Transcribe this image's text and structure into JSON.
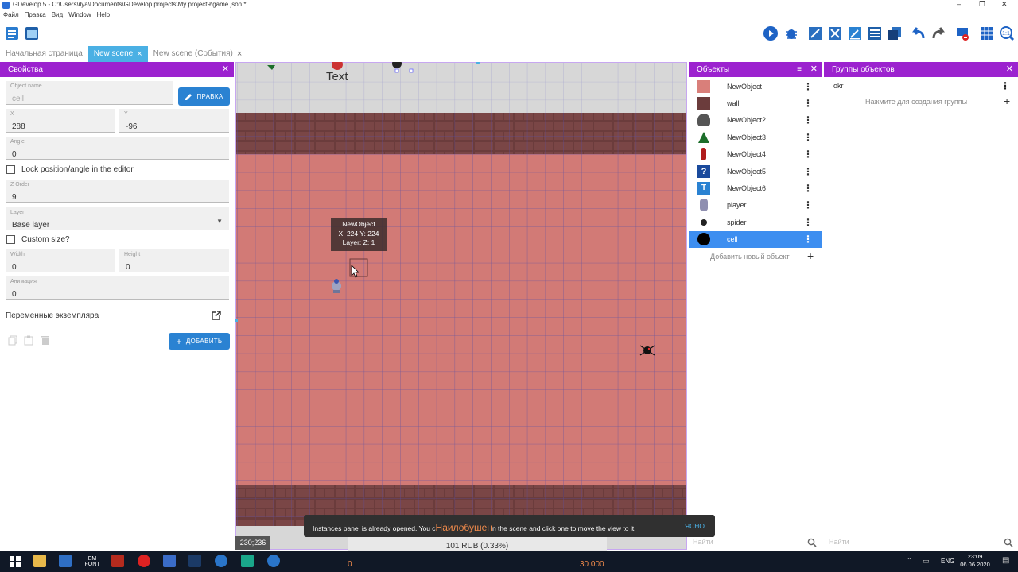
{
  "window": {
    "title": "GDevelop 5 - C:\\Users\\ilya\\Documents\\GDevelop projects\\My project9\\game.json *",
    "minimize": "–",
    "maximize": "❐",
    "close": "✕"
  },
  "menu": [
    "Файл",
    "Правка",
    "Вид",
    "Window",
    "Help"
  ],
  "tabs": [
    {
      "label": "Начальная страница",
      "active": false
    },
    {
      "label": "New scene",
      "active": true
    },
    {
      "label": "New scene (События)",
      "active": false
    }
  ],
  "properties": {
    "header": "Свойства",
    "object_name_label": "Object name",
    "object_name_value": "cell",
    "edit_button": "ПРАВКА",
    "x_label": "X",
    "x_value": "288",
    "y_label": "Y",
    "y_value": "-96",
    "angle_label": "Angle",
    "angle_value": "0",
    "lock_label": "Lock position/angle in the editor",
    "z_order_label": "Z Order",
    "z_order_value": "9",
    "layer_label": "Layer",
    "layer_value": "Base layer",
    "custom_size_label": "Custom size?",
    "width_label": "Width",
    "width_value": "0",
    "height_label": "Height",
    "height_value": "0",
    "animation_label": "Анимация",
    "animation_value": "0",
    "instance_vars_label": "Переменные экземпляра",
    "add_button": "ДОБАВИТЬ"
  },
  "scene": {
    "text_object": "Text",
    "tooltip": {
      "name": "NewObject",
      "coords": "X: 224  Y: 224",
      "layer": "Layer:   Z: 1"
    },
    "coords_badge": "230;236",
    "colors": {
      "floor": "#d27a76",
      "wall": "#6b3c3c",
      "grid": "#5b4fa2",
      "outside": "#d7d7d7"
    }
  },
  "objects": {
    "header": "Объекты",
    "items": [
      {
        "name": "NewObject",
        "icon": "pink-square-icon",
        "color": "#d97f7a"
      },
      {
        "name": "wall",
        "icon": "brown-square-icon",
        "color": "#6b3c3c"
      },
      {
        "name": "NewObject2",
        "icon": "rock-icon",
        "color": "#555"
      },
      {
        "name": "NewObject3",
        "icon": "tree-icon",
        "color": "#1c6e2a"
      },
      {
        "name": "NewObject4",
        "icon": "red-figure-icon",
        "color": "#b01c1c"
      },
      {
        "name": "NewObject5",
        "icon": "question-icon",
        "color": "#1a4a9c"
      },
      {
        "name": "NewObject6",
        "icon": "text-object-icon",
        "color": "#2a82d2"
      },
      {
        "name": "player",
        "icon": "player-icon",
        "color": "#8f8fb0"
      },
      {
        "name": "spider",
        "icon": "spider-icon",
        "color": "#222"
      },
      {
        "name": "cell",
        "icon": "black-circle-icon",
        "color": "#000",
        "selected": true
      }
    ],
    "add_new": "Добавить новый объект",
    "search_placeholder": "Найти"
  },
  "groups": {
    "header": "Группы объектов",
    "items": [
      {
        "name": "okr"
      }
    ],
    "create_hint": "Нажмите для создания группы",
    "search_placeholder": "Найти"
  },
  "toast": {
    "message_start": "Instances panel is already opened. You c",
    "overlay": "Наилобушен",
    "message_end": "n the scene and click one to move the view to it.",
    "action": "ЯСНО"
  },
  "stream_overlay": {
    "amount": "101 RUB (0.33%)",
    "min": "0",
    "max": "30 000",
    "progress_fraction": 0.0033
  },
  "taskbar": {
    "lang": "ENG",
    "time": "23:09",
    "date": "06.06.2020",
    "app_text": "ЕМ FONT"
  }
}
